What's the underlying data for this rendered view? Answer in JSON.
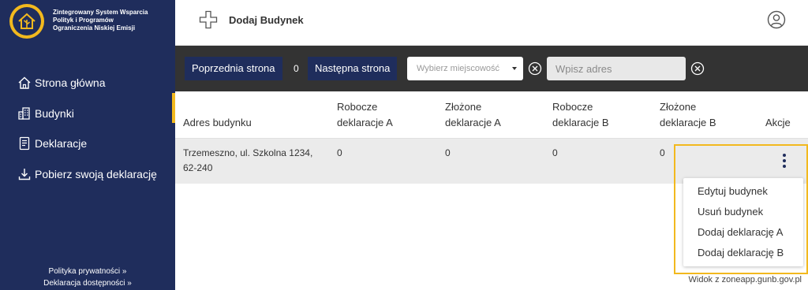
{
  "app": {
    "title_lines": [
      "Zintegrowany System Wsparcia",
      "Polityk i Programów",
      "Ograniczenia Niskiej Emisji"
    ]
  },
  "sidebar": {
    "items": [
      {
        "label": "Strona główna",
        "icon": "home-icon"
      },
      {
        "label": "Budynki",
        "icon": "buildings-icon"
      },
      {
        "label": "Deklaracje",
        "icon": "document-icon"
      },
      {
        "label": "Pobierz swoją deklarację",
        "icon": "download-icon"
      }
    ],
    "footer": [
      "Polityka prywatności »",
      "Deklaracja dostępności »"
    ]
  },
  "topbar": {
    "add_label": "Dodaj Budynek"
  },
  "filters": {
    "prev_label": "Poprzednia strona",
    "page": "0",
    "next_label": "Następna strona",
    "city_placeholder": "Wybierz miejscowość",
    "address_placeholder": "Wpisz adres"
  },
  "table": {
    "headers": [
      "Adres budynku",
      [
        "Robocze",
        "deklaracje A"
      ],
      [
        "Złożone",
        "deklaracje A"
      ],
      [
        "Robocze",
        "deklaracje B"
      ],
      [
        "Złożone",
        "deklaracje B"
      ],
      "Akcje"
    ],
    "rows": [
      {
        "address": [
          "Trzemeszno, ul. Szkolna 1234,",
          "62-240"
        ],
        "draft_a": "0",
        "submitted_a": "0",
        "draft_b": "0",
        "submitted_b": "0"
      }
    ]
  },
  "menu": {
    "items": [
      "Edytuj budynek",
      "Usuń budynek",
      "Dodaj deklarację A",
      "Dodaj deklarację B"
    ]
  },
  "watermark": "Widok z zoneapp.gunb.gov.pl",
  "colors": {
    "sidebar": "#1f2d5c",
    "accent": "#f2b91e",
    "filterbar": "#333333"
  }
}
